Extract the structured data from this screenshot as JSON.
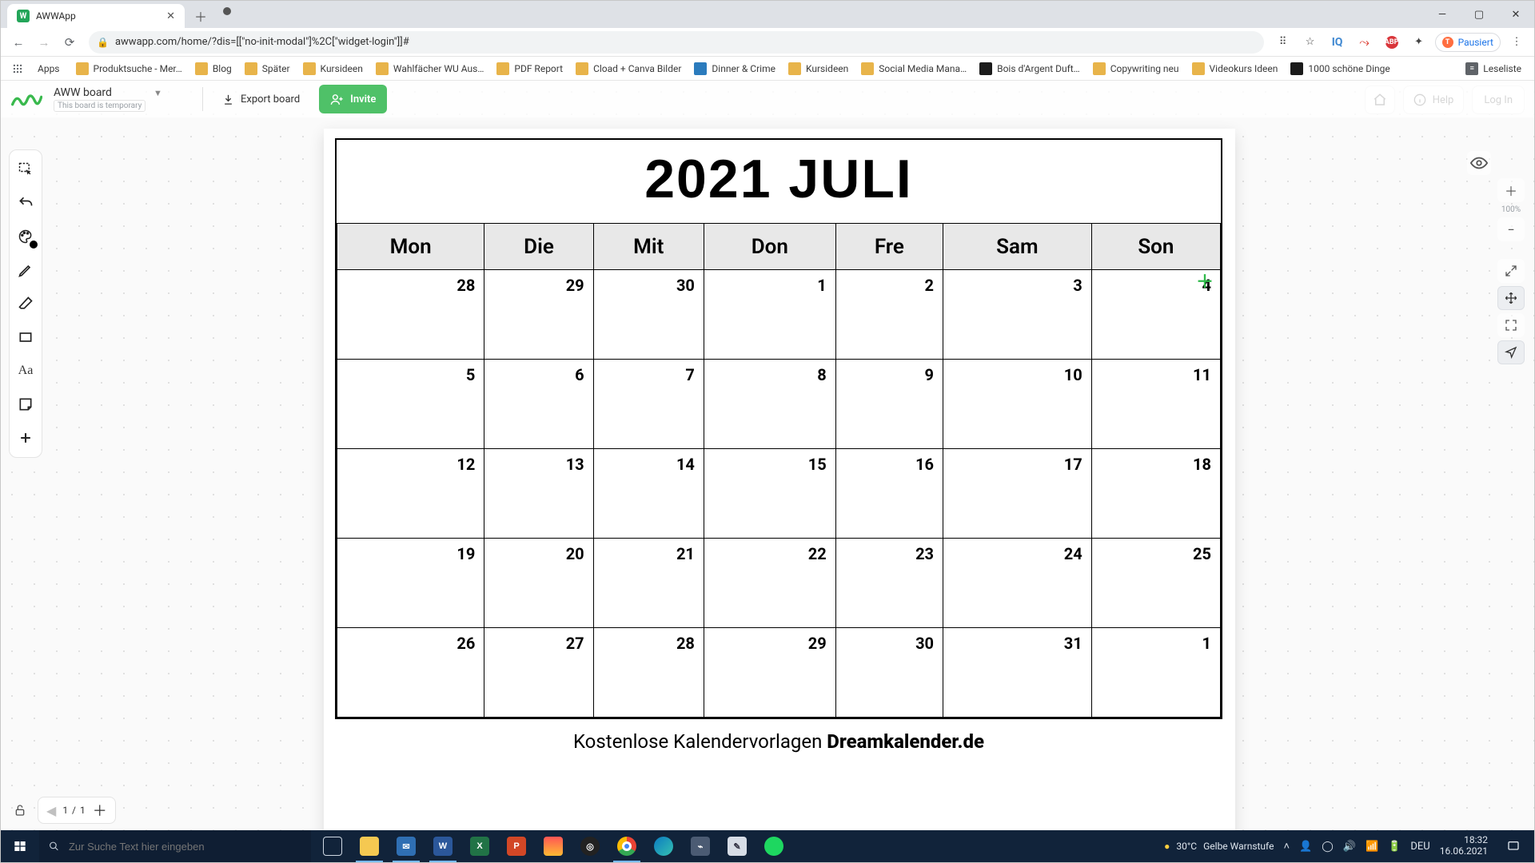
{
  "browser": {
    "tab_title": "AWWApp",
    "tab_favicon_letter": "W",
    "new_tab_tooltip": "Neuer Tab",
    "url": "awwapp.com/home/?dis=[[\"no-init-modal\"]%2C[\"widget-login\"]]#",
    "profile_label": "Pausiert",
    "profile_initial": "T",
    "apps_label": "Apps",
    "bookmarks": [
      "Produktsuche - Mer…",
      "Blog",
      "Später",
      "Kursideen",
      "Wahlfächer WU Aus…",
      "PDF Report",
      "Cload + Canva Bilder",
      "Dinner & Crime",
      "Kursideen",
      "Social Media Mana…",
      "Bois d'Argent Duft…",
      "Copywriting neu",
      "Videokurs Ideen",
      "1000 schöne Dinge"
    ],
    "bookmarks_right": "Leseliste"
  },
  "aww": {
    "board_name": "AWW board",
    "board_temp_label": "This board is temporary",
    "export_label": "Export board",
    "invite_label": "Invite",
    "help_label": "Help",
    "login_label": "Log In",
    "zoom_label": "100%",
    "page_current": "1",
    "page_total": "1"
  },
  "calendar": {
    "title": "2021 JULI",
    "days": [
      "Mon",
      "Die",
      "Mit",
      "Don",
      "Fre",
      "Sam",
      "Son"
    ],
    "weeks": [
      [
        "28",
        "29",
        "30",
        "1",
        "2",
        "3",
        "4"
      ],
      [
        "5",
        "6",
        "7",
        "8",
        "9",
        "10",
        "11"
      ],
      [
        "12",
        "13",
        "14",
        "15",
        "16",
        "17",
        "18"
      ],
      [
        "19",
        "20",
        "21",
        "22",
        "23",
        "24",
        "25"
      ],
      [
        "26",
        "27",
        "28",
        "29",
        "30",
        "31",
        "1"
      ]
    ],
    "caption_prefix": "Kostenlose Kalendervorlagen ",
    "caption_brand": "Dreamkalender.de"
  },
  "taskbar": {
    "search_placeholder": "Zur Suche Text hier eingeben",
    "weather_temp": "30°C",
    "weather_text": "Gelbe Warnstufe",
    "lang": "DEU",
    "time": "18:32",
    "date": "16.06.2021"
  }
}
